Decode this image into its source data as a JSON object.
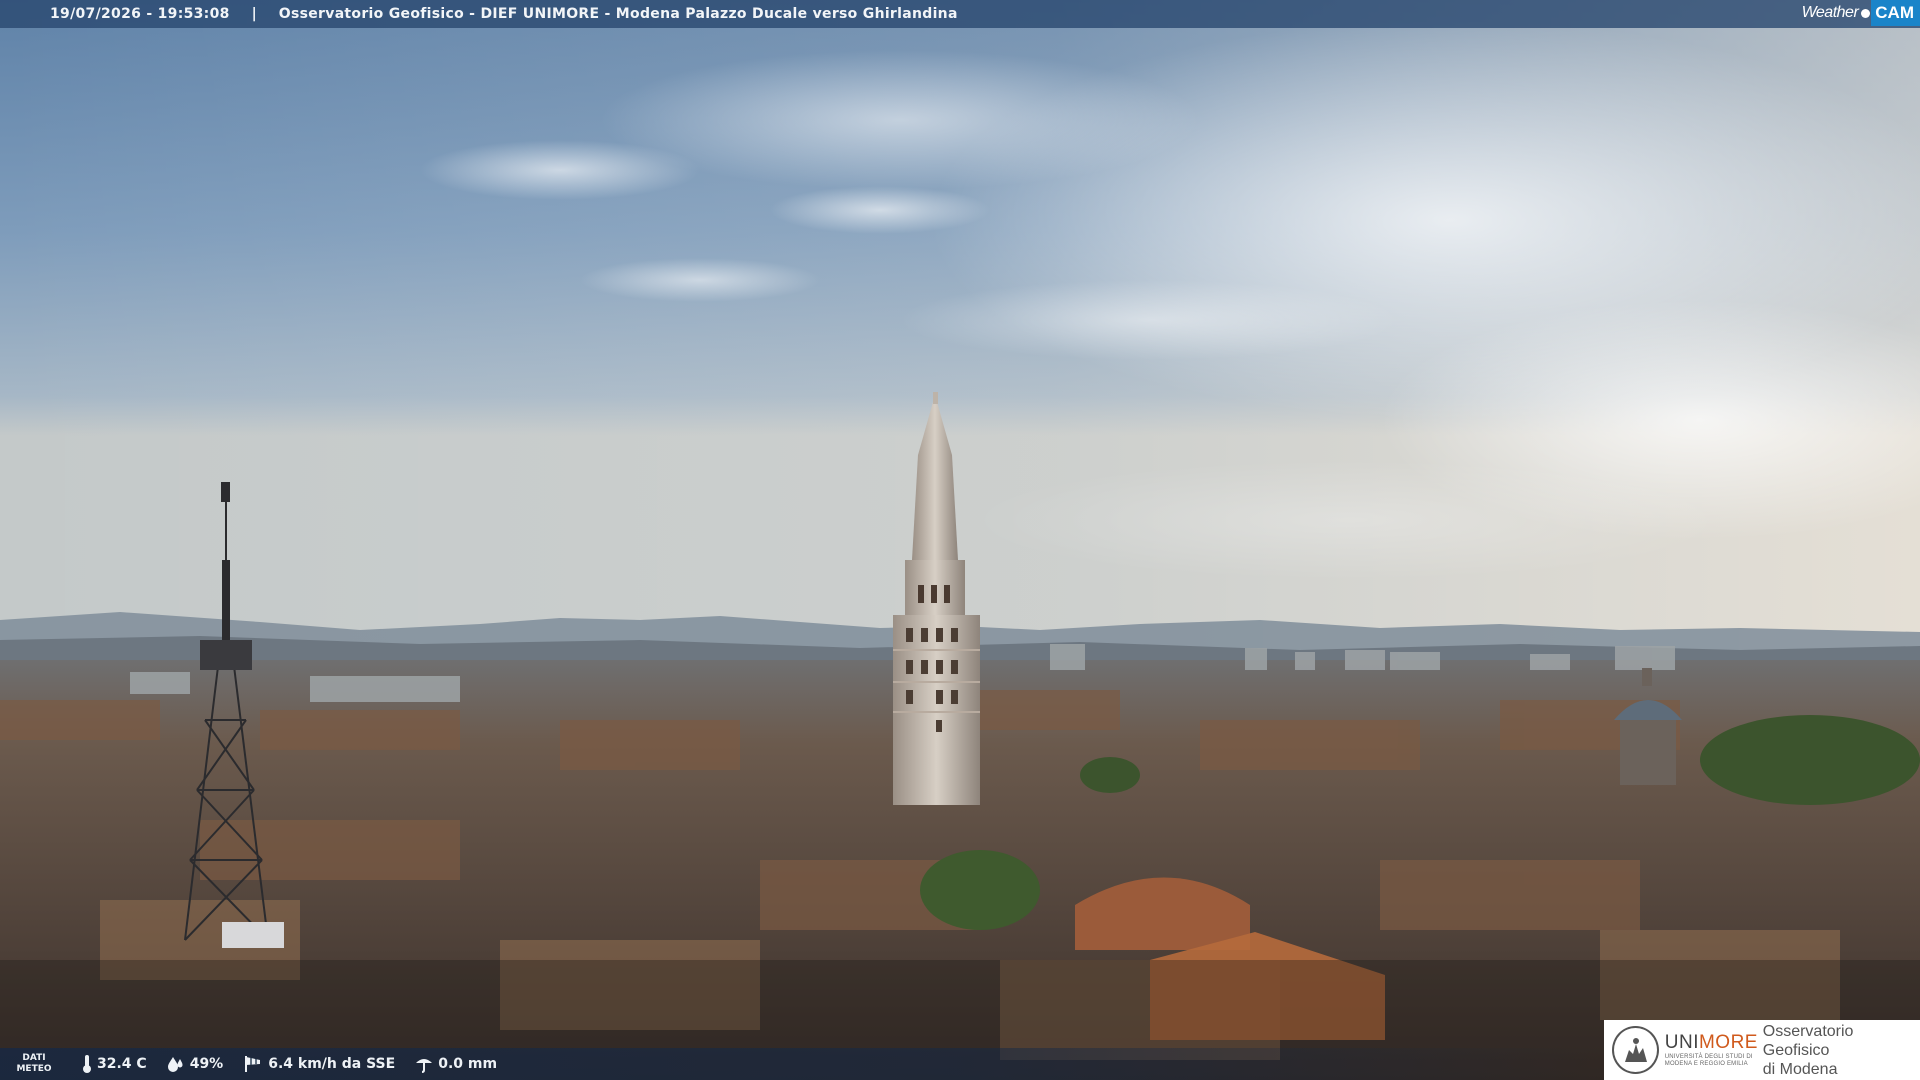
{
  "header": {
    "datetime": "19/07/2026 - 19:53:08",
    "separator": "|",
    "title": "Osservatorio Geofisico - DIEF UNIMORE - Modena Palazzo Ducale verso Ghirlandina"
  },
  "brand": {
    "weather": "Weather",
    "cam": "CAM",
    "accent": "#1a84c9"
  },
  "meteo": {
    "label_line1": "DATI",
    "label_line2": "METEO",
    "temperature": "32.4 C",
    "humidity": "49%",
    "wind": "6.4 km/h da SSE",
    "rain": "0.0 mm",
    "icons": [
      "thermometer-icon",
      "humidity-drop-icon",
      "wind-sock-icon",
      "rain-gauge-icon"
    ]
  },
  "logo": {
    "uni_part1": "UNI",
    "uni_part2": "MORE",
    "uni_sub_line1": "UNIVERSITÀ DEGLI STUDI DI",
    "uni_sub_line2": "MODENA E REGGIO EMILIA",
    "observatory_line1": "Osservatorio Geofisico",
    "observatory_line2": "di Modena",
    "accent": "#d05a1c"
  }
}
